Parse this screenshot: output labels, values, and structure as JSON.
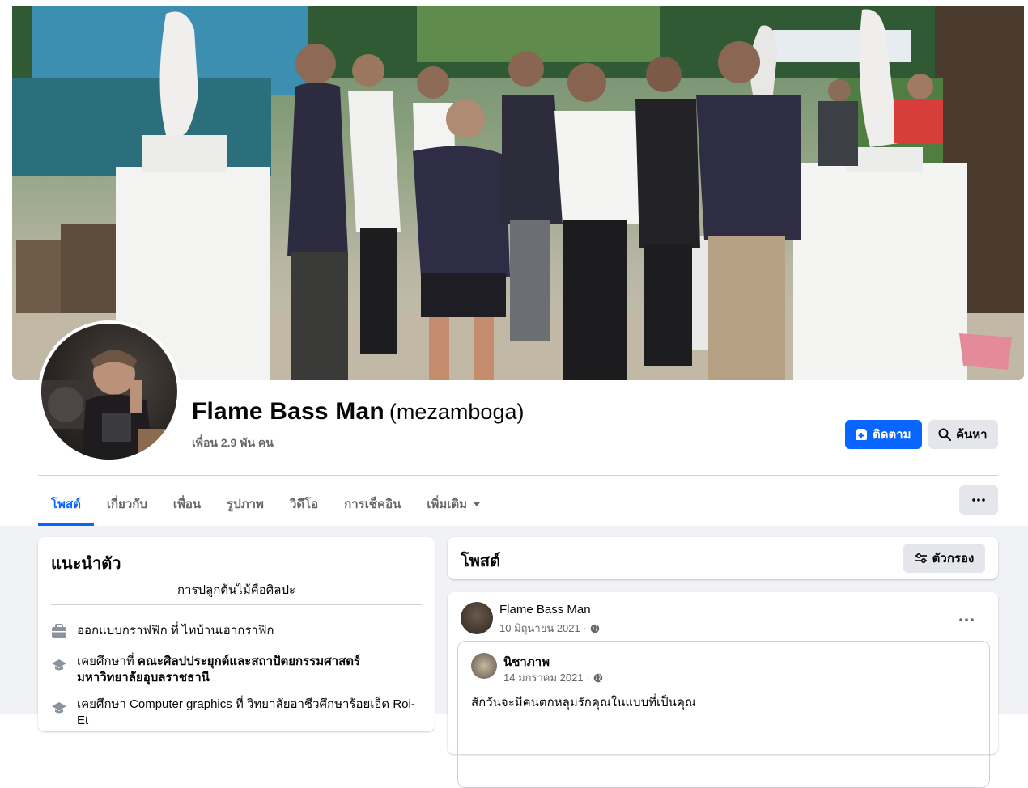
{
  "profile": {
    "name": "Flame Bass Man",
    "alternate_name": "(mezamboga)",
    "friends": "เพื่อน 2.9 พัน คน"
  },
  "actions": {
    "follow_label": "ติดตาม",
    "search_label": "ค้นหา"
  },
  "tabs": [
    {
      "label": "โพสต์",
      "active": true
    },
    {
      "label": "เกี่ยวกับ"
    },
    {
      "label": "เพื่อน"
    },
    {
      "label": "รูปภาพ"
    },
    {
      "label": "วิดีโอ"
    },
    {
      "label": "การเช็คอิน"
    },
    {
      "label": "เพิ่มเติม"
    }
  ],
  "more_menu_icon": "ellipsis-icon",
  "intro": {
    "title": "แนะนำตัว",
    "bio": "การปลูกต้นไม้คือศิลปะ",
    "items": [
      {
        "icon": "briefcase-icon",
        "prefix": "ออกแบบกราฟฟิก ที่ ไทบ้านเฮากราฟิก",
        "bold": ""
      },
      {
        "icon": "graduation-cap-icon",
        "prefix": "เคยศึกษาที่ ",
        "bold": "คณะศิลปประยุกต์และสถาปัตยกรรมศาสตร์ มหาวิทยาลัยอุบลราชธานี"
      },
      {
        "icon": "graduation-cap-icon",
        "prefix": "เคยศึกษา Computer graphics ที่ วิทยาลัยอาชีวศึกษาร้อยเอ็ด Roi-Et",
        "bold": ""
      }
    ]
  },
  "posts": {
    "title": "โพสต์",
    "filter_label": "ตัวกรอง"
  },
  "post": {
    "author": "Flame Bass Man",
    "date": "10 มิถุนายน 2021 ·",
    "shared": {
      "author": "นิชาภาพ",
      "date": "14 มกราคม 2021 ·",
      "text": "สักวันจะมีคนตกหลุมรักคุณในแบบที่เป็นคุณ"
    }
  },
  "colors": {
    "accent": "#0866ff",
    "secondary_button": "#e4e6eb",
    "muted_text": "#65676b",
    "feed_background": "#f0f2f5"
  }
}
